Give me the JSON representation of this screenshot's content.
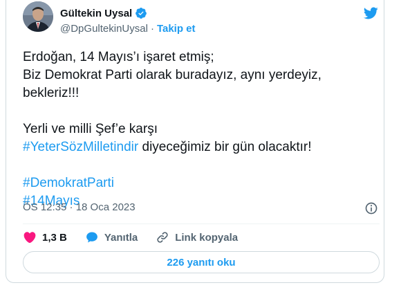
{
  "author": {
    "name": "Gültekin Uysal",
    "handle": "@DpGultekinUysal",
    "separator": "·",
    "follow_label": "Takip et"
  },
  "tweet": {
    "line1": "Erdoğan, 14 Mayıs’ı işaret etmiş;",
    "line2": "Biz Demokrat Parti olarak buradayız, aynı yerdeyiz,",
    "line3": "bekleriz!!!",
    "line4": "Yerli ve milli Şef’e karşı",
    "hashtag1": "#YeterSözMilletindir",
    "line5_rest": " diyeceğimiz bir gün olacaktır!",
    "hashtag2": "#DemokratParti",
    "hashtag3": "#14Mayıs"
  },
  "meta": {
    "timestamp": "ÖS 12:35 · 18 Oca 2023"
  },
  "actions": {
    "likes": "1,3 B",
    "reply_label": "Yanıtla",
    "copy_link_label": "Link kopyala"
  },
  "replies_button": "226 yanıtı oku",
  "colors": {
    "accent": "#1d9bf0",
    "like": "#f91880",
    "text": "#0f1419",
    "secondary": "#536471"
  }
}
